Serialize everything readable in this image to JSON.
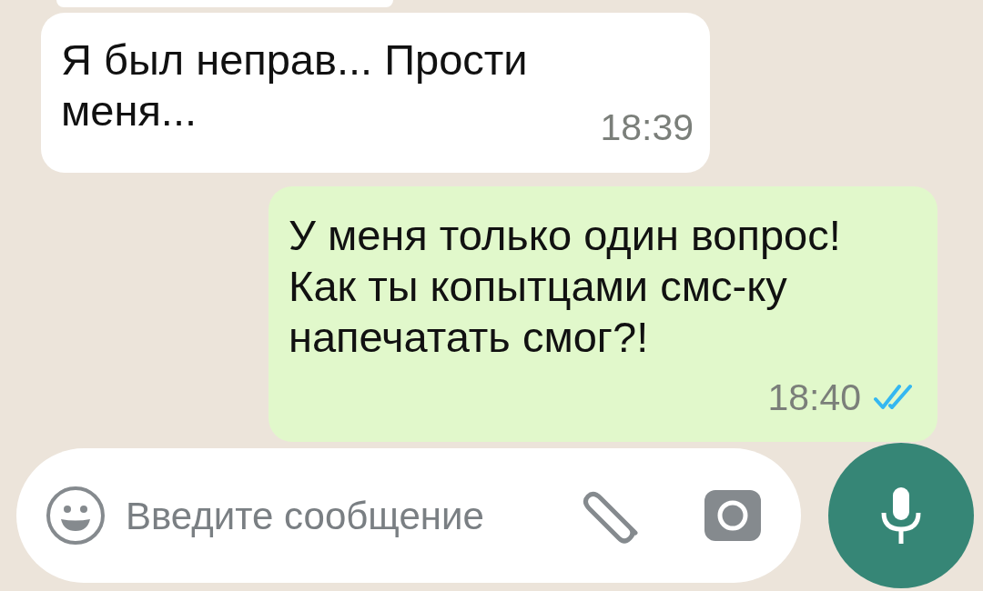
{
  "messages": [
    {
      "kind": "incoming",
      "text": "Я был неправ... Прости меня...",
      "time": "18:39"
    },
    {
      "kind": "outgoing",
      "text": "У меня только один вопрос! Как ты копытцами смс-ку напечатать смог?!",
      "time": "18:40",
      "read": true
    }
  ],
  "composer": {
    "placeholder": "Введите сообщение"
  }
}
